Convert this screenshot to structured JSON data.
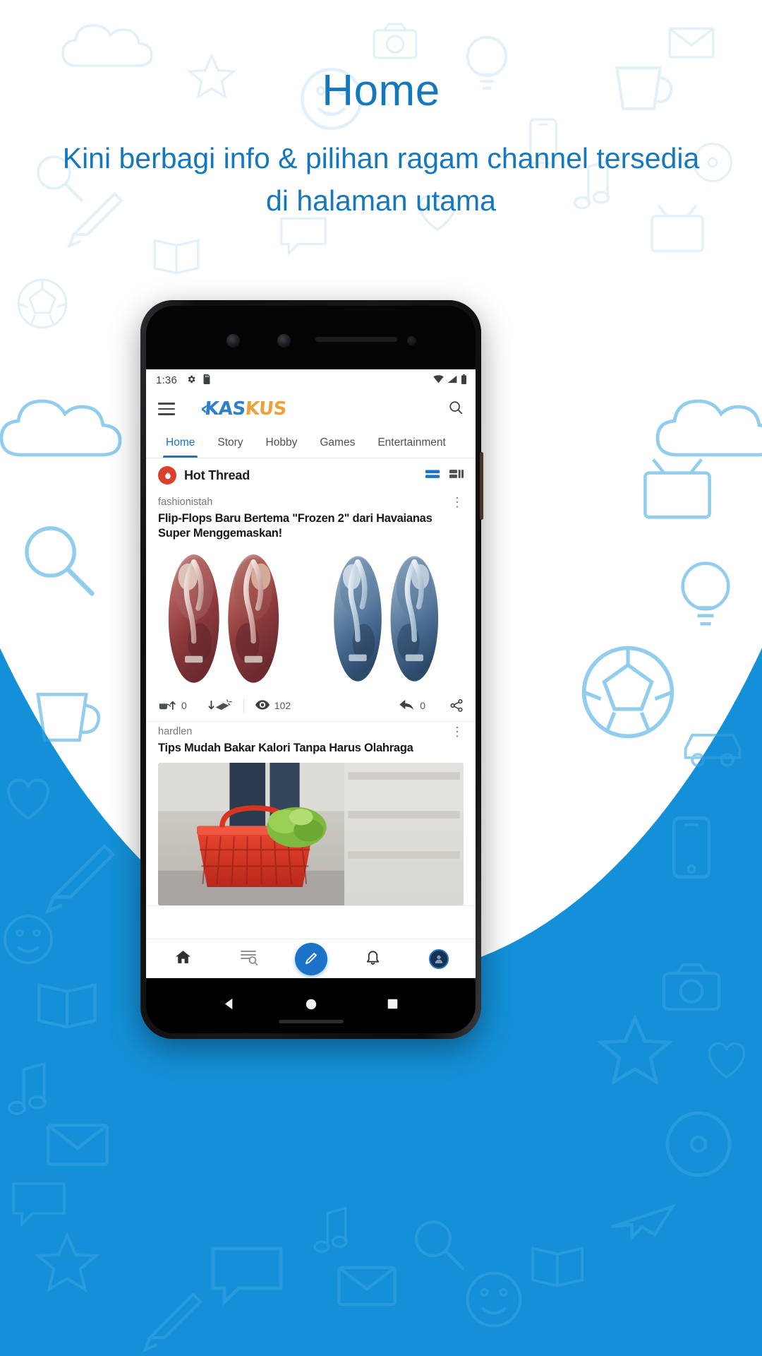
{
  "promo": {
    "title": "Home",
    "subtitle": "Kini berbagi info & pilihan ragam channel tersedia di halaman utama",
    "accent_color": "#1478be",
    "background_color": "#1490d8"
  },
  "phone": {
    "status_bar": {
      "time": "1:36",
      "left_icons": [
        "gear-icon",
        "sd-card-icon"
      ],
      "right_icons": [
        "wifi-icon",
        "signal-icon",
        "battery-icon"
      ]
    },
    "app_bar": {
      "menu_icon": "hamburger-menu-icon",
      "brand_first": "KAS",
      "brand_second": "KUS",
      "brand_arrow": "‹",
      "search_icon": "search-icon"
    },
    "tabs": [
      {
        "label": "Home",
        "active": true
      },
      {
        "label": "Story",
        "active": false
      },
      {
        "label": "Hobby",
        "active": false
      },
      {
        "label": "Games",
        "active": false
      },
      {
        "label": "Entertainment",
        "active": false
      }
    ],
    "section": {
      "icon": "flame-icon",
      "title": "Hot Thread",
      "view_toggles": [
        "list-view-icon",
        "grid-view-icon"
      ],
      "active_toggle": "list-view-icon"
    },
    "posts": [
      {
        "author": "fashionistah",
        "menu_icon": "more-vertical-icon",
        "title": "Flip-Flops Baru Bertema \"Frozen 2\" dari Havaianas Super Menggemaskan!",
        "media": "frozen-flip-flops-photo",
        "actions": {
          "upvote_icon": "cendol-up-icon",
          "upvote_count": "0",
          "downvote_icon": "bata-down-icon",
          "views_icon": "eye-icon",
          "views_count": "102",
          "reply_icon": "reply-icon",
          "reply_count": "0",
          "share_icon": "share-icon"
        }
      },
      {
        "author": "hardlen",
        "menu_icon": "more-vertical-icon",
        "title": "Tips Mudah Bakar Kalori Tanpa Harus Olahraga",
        "media": "shopping-basket-photo"
      }
    ],
    "bottom_nav": [
      {
        "icon": "home-icon",
        "active": true
      },
      {
        "icon": "forum-search-icon",
        "active": false
      },
      {
        "icon": "create-post-icon",
        "active": false,
        "is_fab": true
      },
      {
        "icon": "notification-bell-icon",
        "active": false
      },
      {
        "icon": "profile-avatar-icon",
        "active": false
      }
    ],
    "android_nav": [
      "back-triangle-icon",
      "home-circle-icon",
      "recents-square-icon"
    ]
  }
}
